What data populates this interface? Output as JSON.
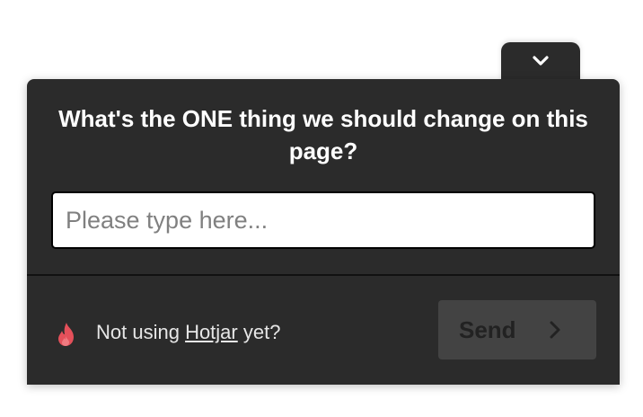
{
  "widget": {
    "question": "What's the ONE thing we should change on this page?",
    "input": {
      "placeholder": "Please type here...",
      "value": ""
    },
    "footer": {
      "prefix": "Not using ",
      "link_label": "Hotjar",
      "suffix": " yet?",
      "icon": "flame-icon"
    },
    "send_label": "Send",
    "toggle_icon": "chevron-down-icon"
  },
  "colors": {
    "panel": "#2b2b2b",
    "text": "#ffffff",
    "brand_flame": "#e4505a",
    "send_button_bg": "#434343",
    "send_button_text": "#222222"
  }
}
